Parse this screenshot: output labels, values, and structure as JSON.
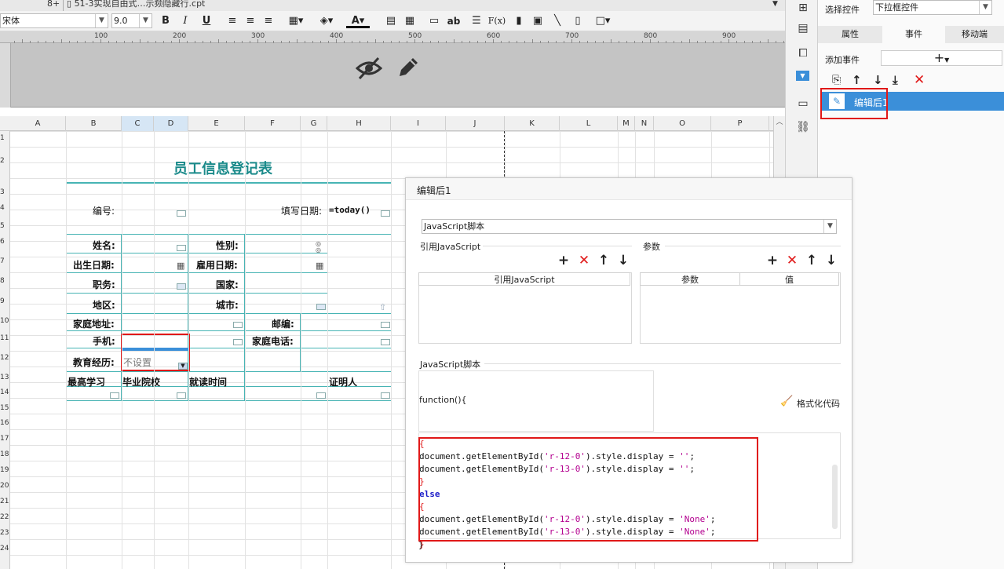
{
  "tabs": {
    "first": "8+",
    "file": "51-3实现自由式…示频隐藏行.cpt"
  },
  "toolbar": {
    "font": "宋体",
    "size": "9.0",
    "bold": "B",
    "italic": "I",
    "underline": "U",
    "font_color": "A",
    "text": "ab",
    "formula": "F(x)"
  },
  "ruler": [
    "100",
    "200",
    "300",
    "400",
    "500",
    "600",
    "700",
    "800",
    "900"
  ],
  "columns": [
    "A",
    "B",
    "C",
    "D",
    "E",
    "F",
    "G",
    "H",
    "I",
    "J",
    "K",
    "L",
    "M",
    "N",
    "O",
    "P"
  ],
  "rows": [
    "1",
    "2",
    "3",
    "4",
    "5",
    "6",
    "7",
    "8",
    "9",
    "10",
    "11",
    "12",
    "13",
    "14",
    "15",
    "16",
    "17",
    "18",
    "19",
    "20",
    "21",
    "22",
    "23",
    "24"
  ],
  "sheet": {
    "title": "员工信息登记表",
    "bianhao": "编号:",
    "tianxie": "填写日期:",
    "today": "=today()",
    "xingming": "姓名:",
    "xingbie": "性别:",
    "chusheng": "出生日期:",
    "guyong": "雇用日期:",
    "zhiwu": "职务:",
    "guojia": "国家:",
    "diqu": "地区:",
    "chengshi": "城市:",
    "jiating": "家庭地址:",
    "youbian": "邮编:",
    "shouji": "手机:",
    "jtdianhua": "家庭电话:",
    "jiaoyu": "教育经历:",
    "bushezhi": "不设置",
    "zuigao": "最高学习",
    "biye": "毕业院校",
    "jiudu": "就读时间",
    "zhengming": "证明人"
  },
  "panel": {
    "select_label": "选择控件",
    "select_value": "下拉框控件",
    "tabs": [
      "属性",
      "事件",
      "移动端"
    ],
    "add_event": "添加事件",
    "event_item": "编辑后1"
  },
  "dialog": {
    "title": "编辑后1",
    "type": "JavaScript脚本",
    "ref_section": "引用JavaScript",
    "param_section": "参数",
    "ref_header": "引用JavaScript",
    "param_header": "参数",
    "value_header": "值",
    "script_section": "JavaScript脚本",
    "function_line": "function(){",
    "format_btn": "格式化代码"
  },
  "code": [
    {
      "t": "{"
    },
    {
      "t": "document.getElementById(",
      "s": "'r-12-0'",
      "r": ").style.display = ",
      "v": "''",
      "e": ";"
    },
    {
      "t": "document.getElementById(",
      "s": "'r-13-0'",
      "r": ").style.display = ",
      "v": "''",
      "e": ";"
    },
    {
      "t": "}"
    },
    {
      "k": "else"
    },
    {
      "t": "{"
    },
    {
      "t": "document.getElementById(",
      "s": "'r-12-0'",
      "r": ").style.display = ",
      "v": "'None'",
      "e": ";"
    },
    {
      "t": "document.getElementById(",
      "s": "'r-13-0'",
      "r": ").style.display = ",
      "v": "'None'",
      "e": ";"
    },
    {
      "t": "}"
    }
  ],
  "colors": {
    "accent": "#3b8fd9",
    "highlight_red": "#e01818",
    "title_teal": "#1a8a8a"
  }
}
